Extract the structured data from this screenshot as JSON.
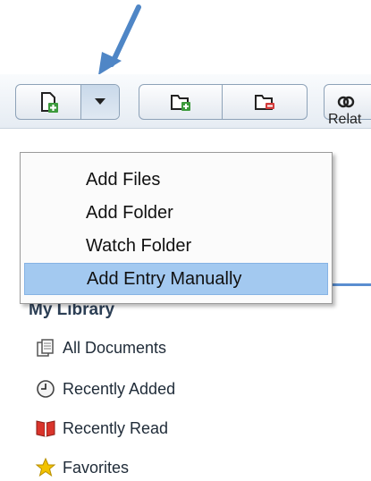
{
  "toolbar": {
    "relat_label": "Relat"
  },
  "menu": {
    "items": [
      {
        "label": "Add Files"
      },
      {
        "label": "Add Folder"
      },
      {
        "label": "Watch Folder"
      },
      {
        "label": "Add Entry Manually"
      }
    ],
    "highlighted": "Add Entry Manually"
  },
  "library": {
    "title": "My Library",
    "items": [
      {
        "label": "All Documents",
        "icon": "documents-icon"
      },
      {
        "label": "Recently Added",
        "icon": "clock-icon"
      },
      {
        "label": "Recently Read",
        "icon": "book-icon"
      },
      {
        "label": "Favorites",
        "icon": "star-icon"
      }
    ]
  },
  "colors": {
    "highlight": "#a3c9f0",
    "arrow": "#4f86c6",
    "star": "#f2c200"
  }
}
